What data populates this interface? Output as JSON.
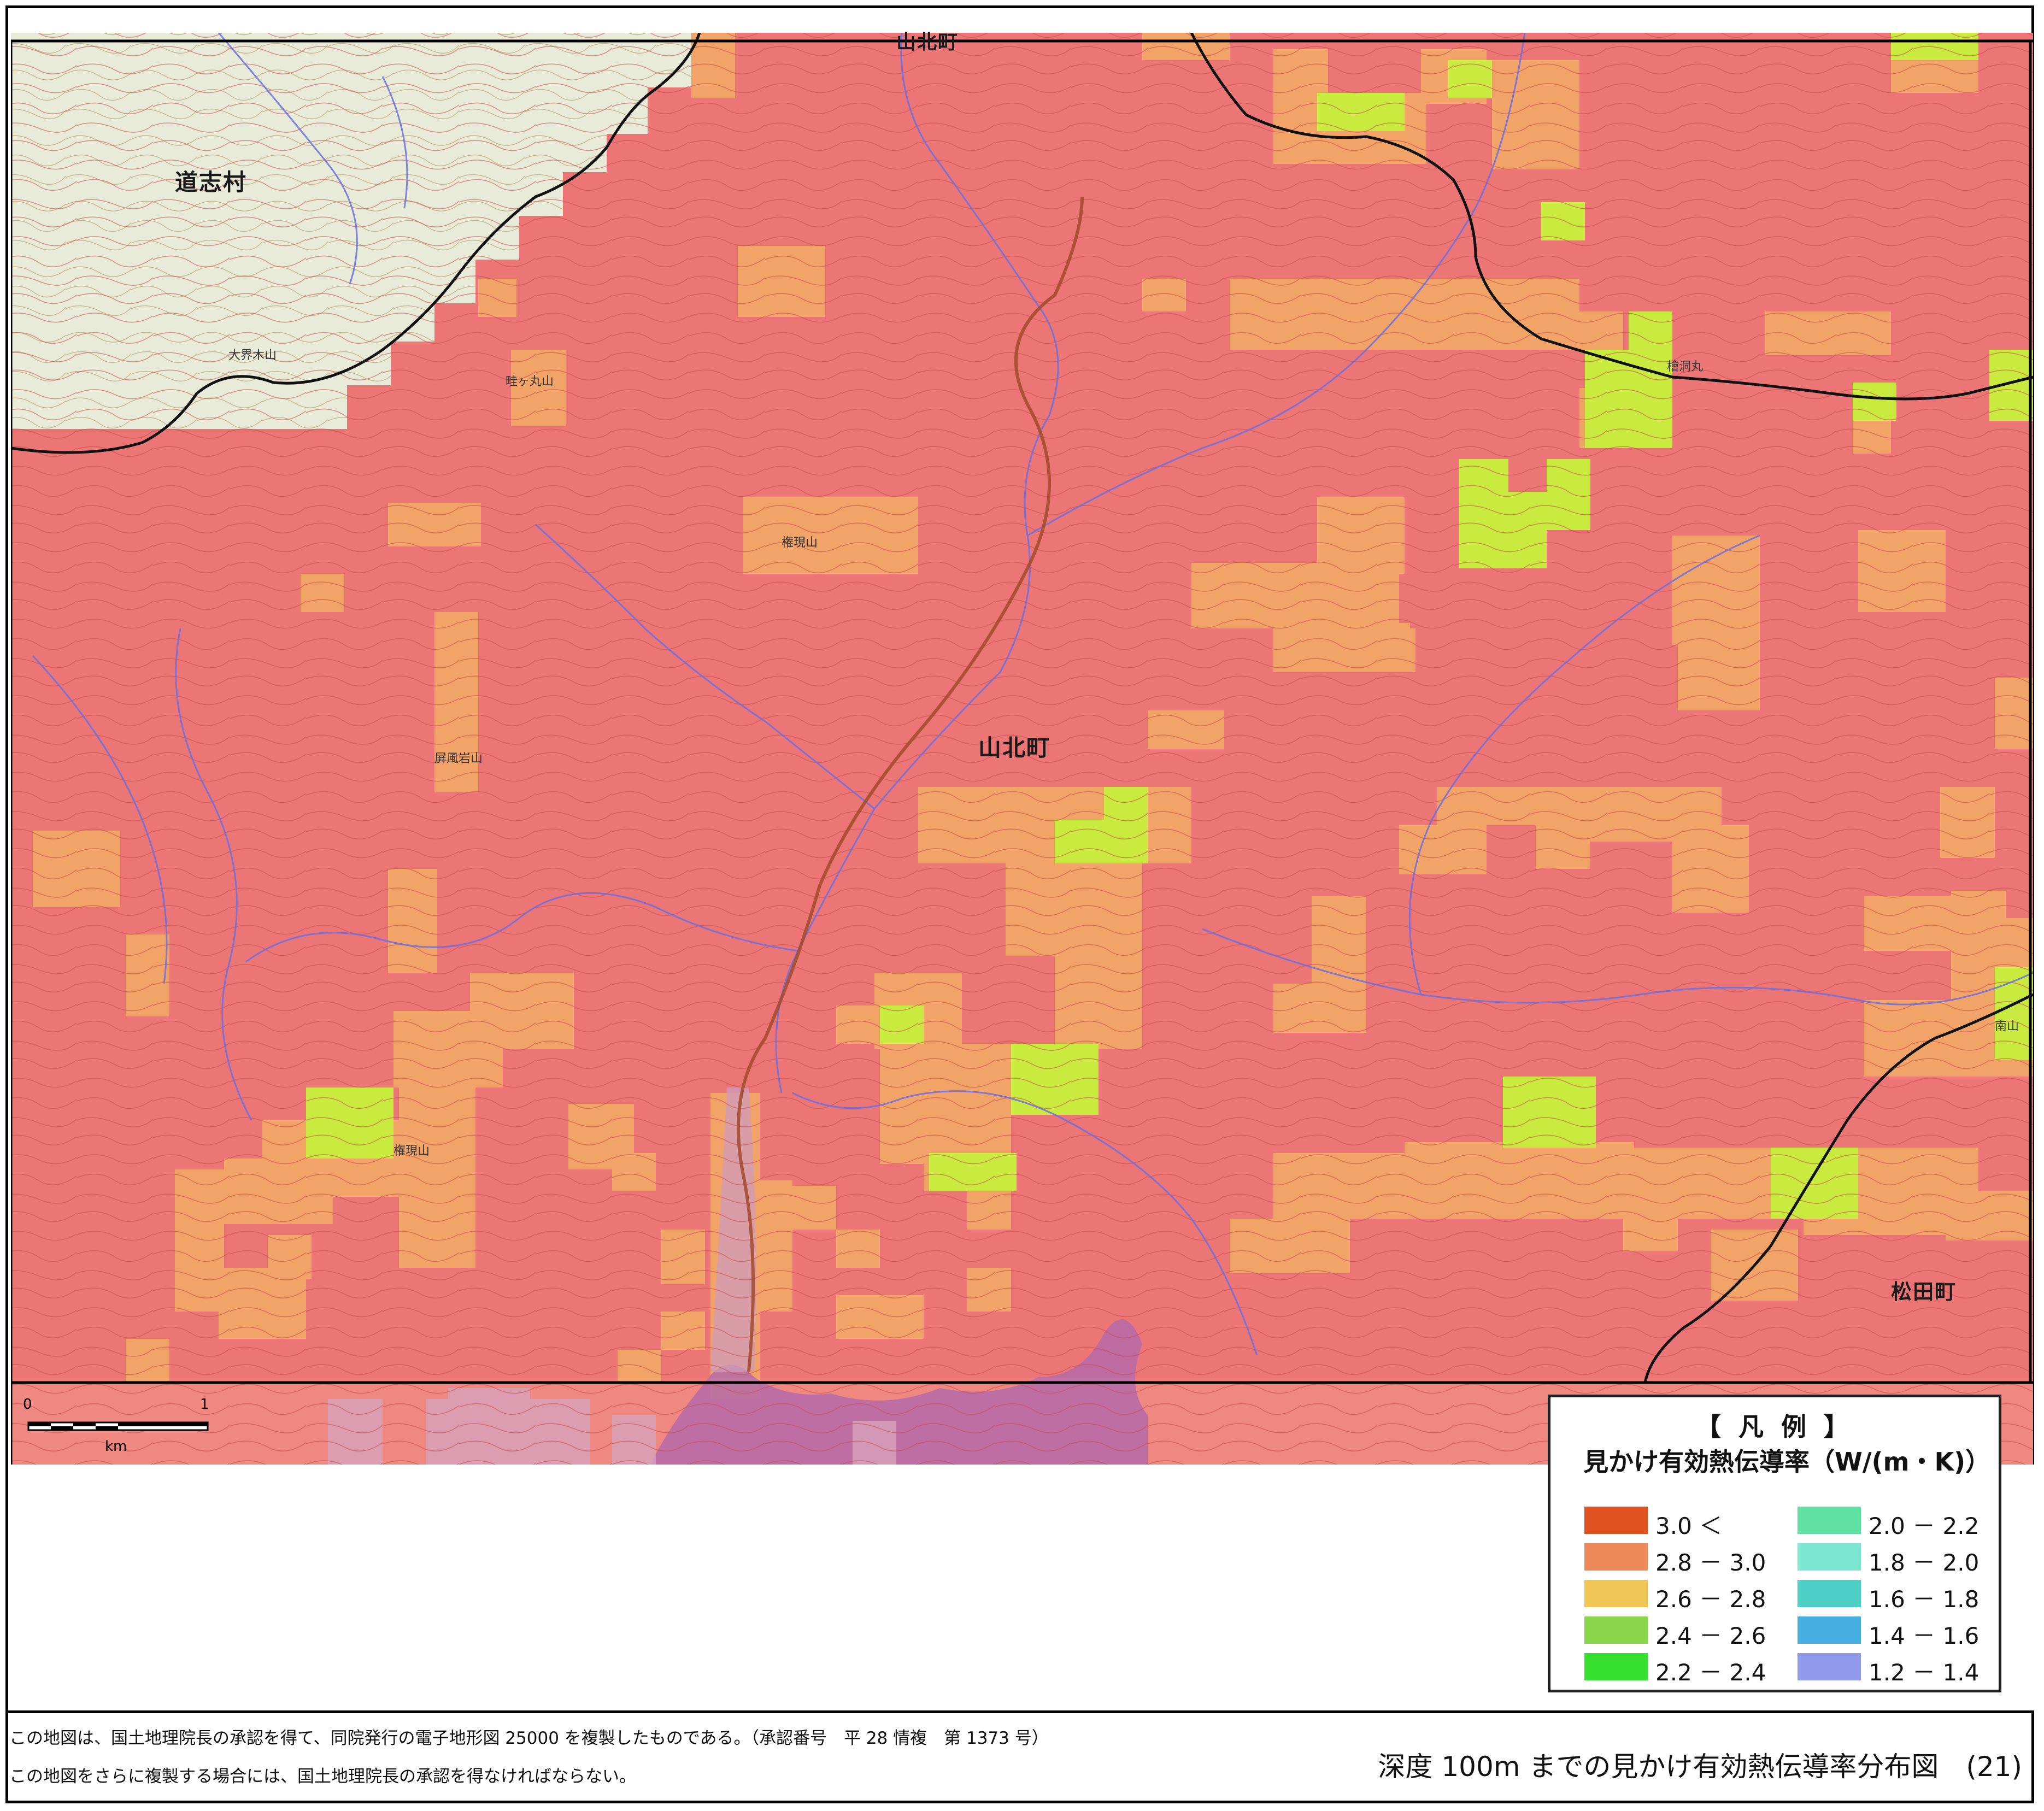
{
  "map": {
    "place_names": {
      "doshi": "道志村",
      "yamakita_top": "山北町",
      "yamakita_center": "山北町",
      "matsuda": "松田町"
    },
    "peak_names": {
      "otohiki": "大界木山",
      "kanaemaru": "畦ヶ丸山",
      "gongen_north": "権現山",
      "gongen_south": "権現山",
      "byobuiwa": "屏風岩山",
      "hinokimaru": "檜洞丸",
      "minamiyama": "南山"
    },
    "colors": {
      "base_pink": "#ec7676",
      "orange_cell": "#f2a468",
      "yellowgreen_cell": "#c9ea3f",
      "old_map": "#e8ebd8",
      "lake": "#b56aa8",
      "contour": "#c55050",
      "river": "#7777dd",
      "road": "#111111"
    }
  },
  "scale": {
    "zero": "0",
    "one": "1",
    "unit": "km"
  },
  "legend": {
    "title": "【 凡 例 】",
    "subtitle": "見かけ有効熱伝導率（W/(m・K)）",
    "items": [
      {
        "label": "3.0 ＜",
        "color": "#e05320"
      },
      {
        "label": "2.8 － 3.0",
        "color": "#ee8a5a"
      },
      {
        "label": "2.6 － 2.8",
        "color": "#f0c657"
      },
      {
        "label": "2.4 － 2.6",
        "color": "#8ad64a"
      },
      {
        "label": "2.2 － 2.4",
        "color": "#35e02e"
      },
      {
        "label": "2.0 － 2.2",
        "color": "#5fe0a0"
      },
      {
        "label": "1.8 － 2.0",
        "color": "#7ee7d2"
      },
      {
        "label": "1.6 － 1.8",
        "color": "#4dcfc6"
      },
      {
        "label": "1.4 － 1.6",
        "color": "#46aee0"
      },
      {
        "label": "1.2 － 1.4",
        "color": "#8f9bea"
      }
    ]
  },
  "footer": {
    "notice_line1": "この地図は、国土地理院長の承認を得て、同院発行の電子地形図 25000 を複製したものである。（承認番号　平 28 情複　第 1373 号）",
    "notice_line2": "この地図をさらに複製する場合には、国土地理院長の承認を得なければならない。",
    "caption": "深度 100m までの見かけ有効熱伝導率分布図　(21)"
  }
}
